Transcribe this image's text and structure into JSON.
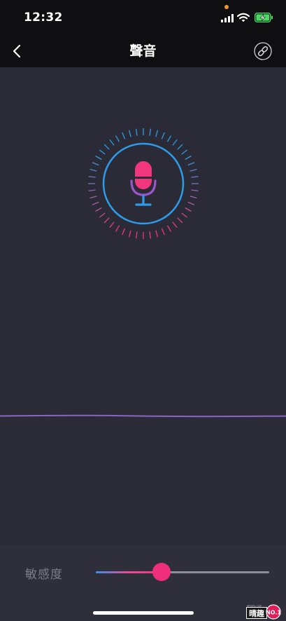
{
  "status_bar": {
    "time": "12:32"
  },
  "nav": {
    "title": "聲音"
  },
  "sensitivity": {
    "label": "敏感度",
    "value": 0.38
  },
  "watermark": {
    "text": "NO.1",
    "brand_top": "INFOKOL.COM",
    "brand_chars": "晴趣"
  },
  "colors": {
    "accent_blue": "#2d9be8",
    "accent_pink": "#f0367d",
    "mic_purple": "#9a55c8",
    "wave_purple": "#8a63c9",
    "battery_green": "#4cd964"
  },
  "icons": {
    "back": "chevron-left-icon",
    "link": "link-icon",
    "mic": "microphone-icon"
  }
}
